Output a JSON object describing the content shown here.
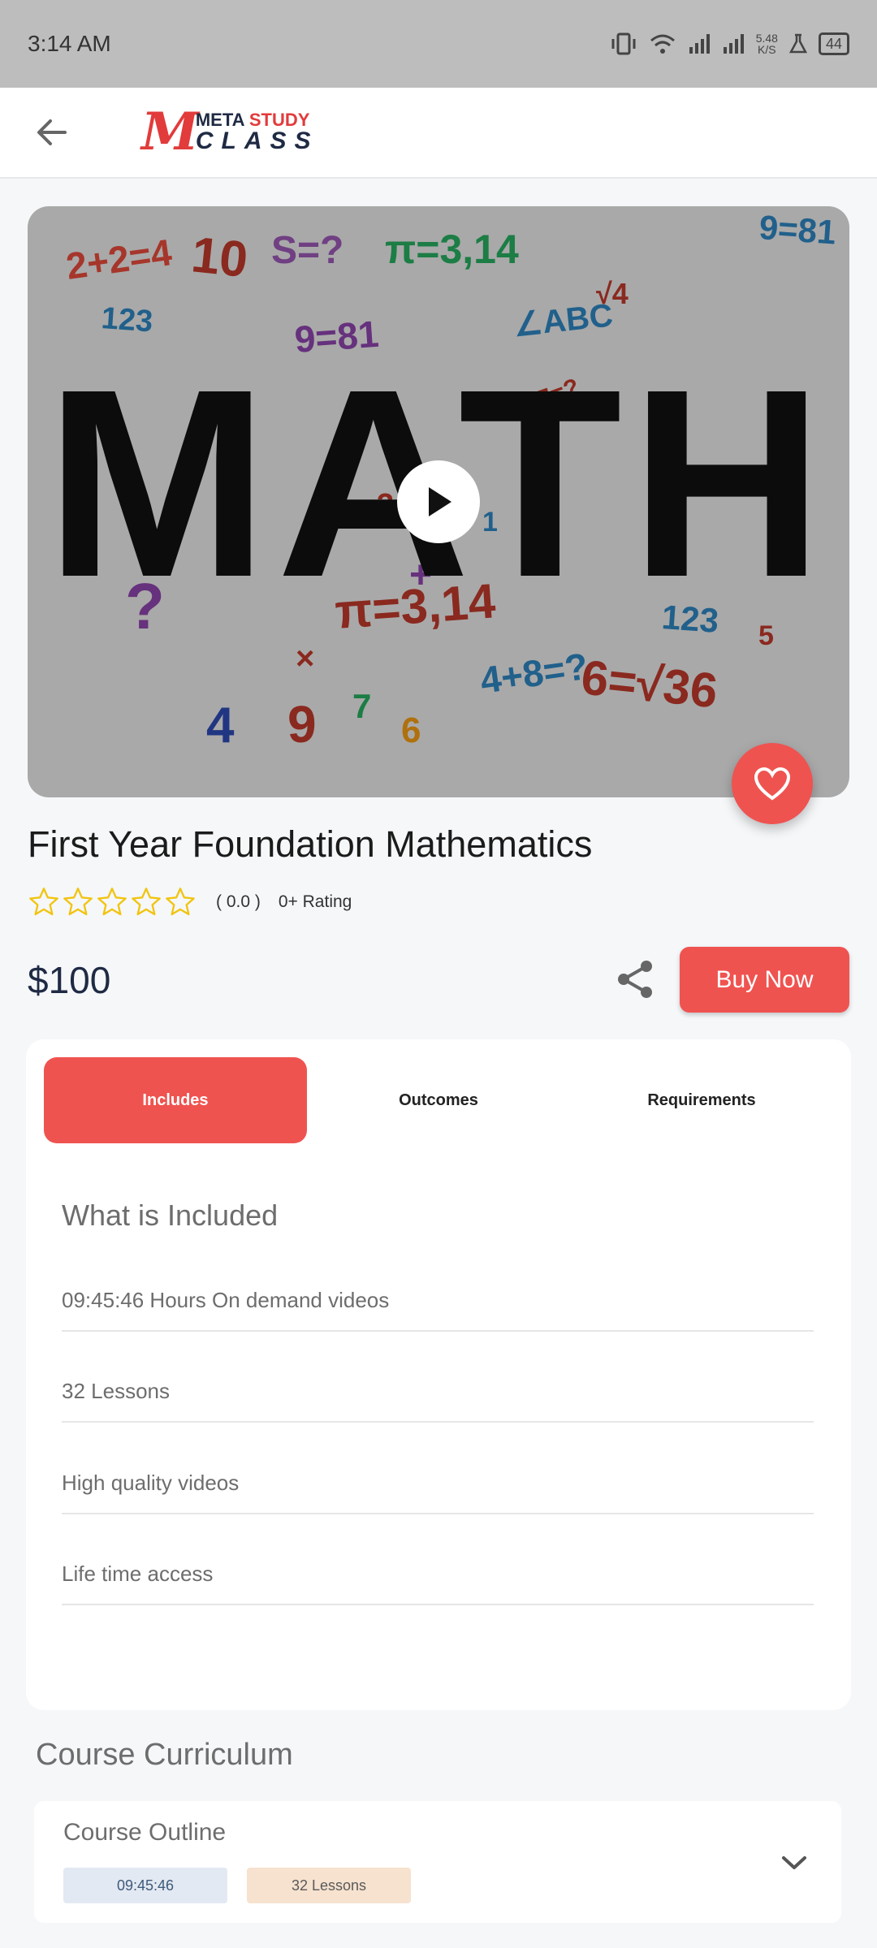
{
  "status_bar": {
    "time": "3:14 AM",
    "speed_value": "5.48",
    "speed_unit": "K/S",
    "battery": "44"
  },
  "app_bar": {
    "logo_meta": "META",
    "logo_study": "STUDY",
    "logo_class": "CLASS",
    "logo_m": "M"
  },
  "course": {
    "title": "First Year Foundation Mathematics",
    "rating_value": "( 0.0 )",
    "rating_count": "0+ Rating",
    "stars": 0,
    "price": "$100",
    "buy_label": "Buy Now"
  },
  "tabs": [
    {
      "label": "Includes",
      "active": true
    },
    {
      "label": "Outcomes",
      "active": false
    },
    {
      "label": "Requirements",
      "active": false
    }
  ],
  "included": {
    "title": "What is Included",
    "items": [
      "09:45:46 Hours On demand videos",
      "32 Lessons",
      "High quality videos",
      "Life time access"
    ]
  },
  "curriculum": {
    "title": "Course Curriculum",
    "outline_title": "Course Outline",
    "duration": "09:45:46",
    "lessons": "32 Lessons"
  },
  "hero_image": {
    "main_word": "MATH",
    "doodles": [
      "2+2=4",
      "10",
      "S=?",
      "123",
      "9=81",
      "π=3,14",
      "∠ABC",
      "√4",
      "9=81",
      "6×7=?",
      "?",
      "π=3,14",
      "4+8=?",
      "6=√36",
      "4",
      "9",
      "7",
      "6",
      "123",
      "5",
      "1",
      "3",
      "+",
      "×"
    ]
  },
  "colors": {
    "accent": "#ef5350",
    "star": "#f1c40f",
    "navy": "#1f2a44"
  }
}
